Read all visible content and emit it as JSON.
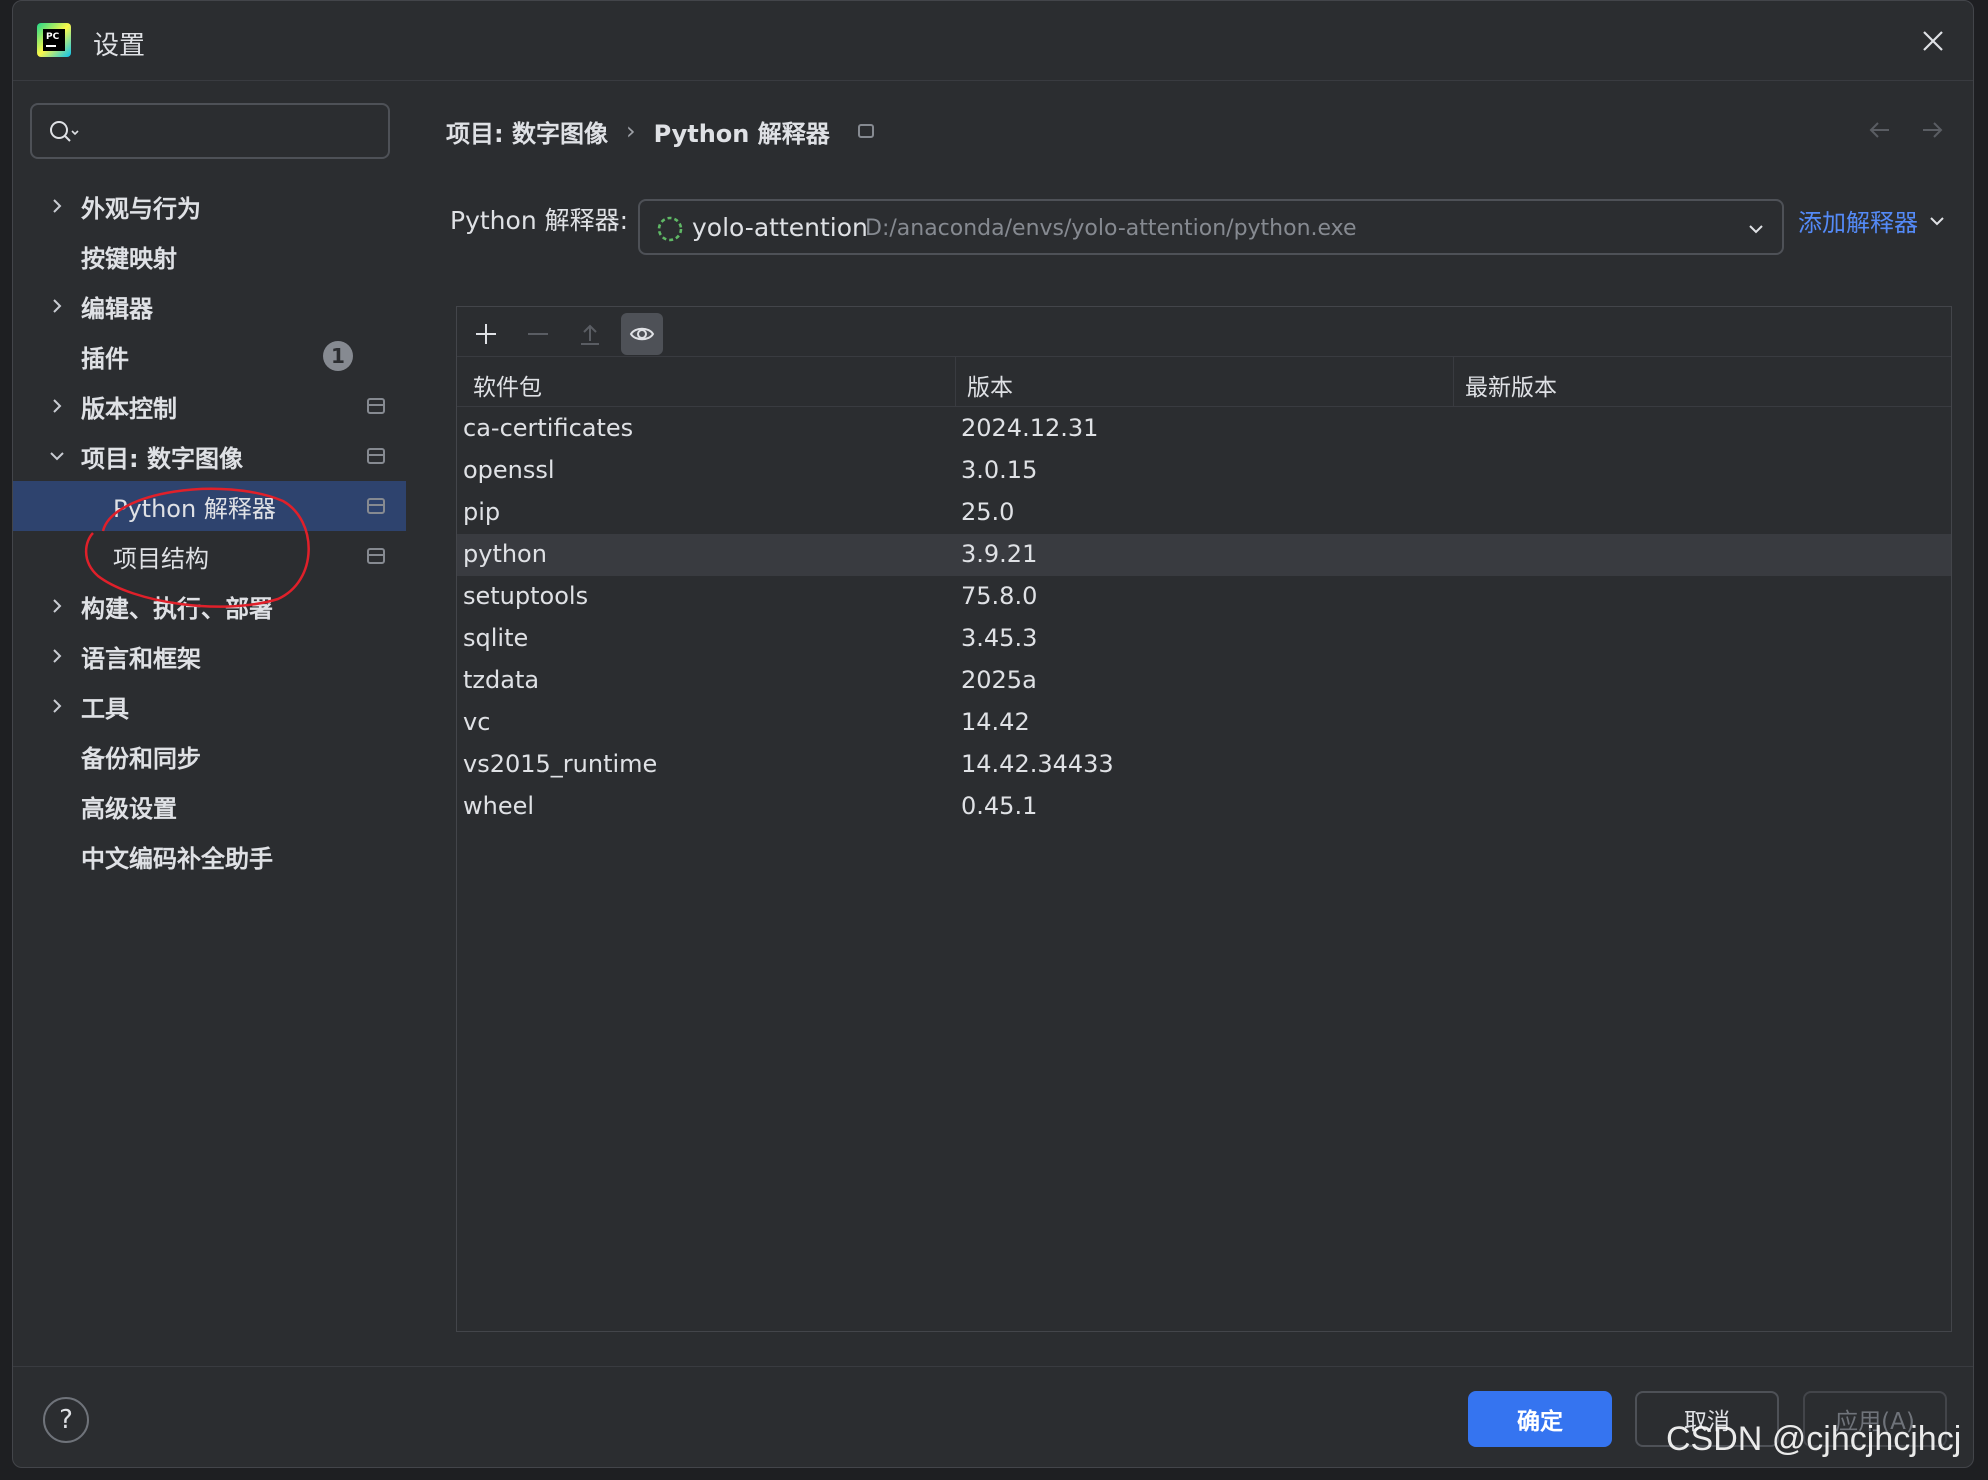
{
  "window": {
    "title": "设置",
    "logo_icon": "pycharm-logo"
  },
  "search": {
    "placeholder": ""
  },
  "sidebar": {
    "items": [
      {
        "label": "外观与行为",
        "expandable": true
      },
      {
        "label": "按键映射",
        "expandable": false
      },
      {
        "label": "编辑器",
        "expandable": true
      },
      {
        "label": "插件",
        "expandable": false,
        "badge": "1"
      },
      {
        "label": "版本控制",
        "expandable": true
      },
      {
        "label": "项目: 数字图像",
        "expandable": true,
        "expanded": true
      },
      {
        "label": "Python 解释器",
        "child": true,
        "selected": true
      },
      {
        "label": "项目结构",
        "child": true
      },
      {
        "label": "构建、执行、部署",
        "expandable": true
      },
      {
        "label": "语言和框架",
        "expandable": true
      },
      {
        "label": "工具",
        "expandable": true
      },
      {
        "label": "备份和同步",
        "expandable": false
      },
      {
        "label": "高级设置",
        "expandable": false
      },
      {
        "label": "中文编码补全助手",
        "expandable": false
      }
    ]
  },
  "breadcrumb": {
    "parent": "项目: 数字图像",
    "separator": "›",
    "current": "Python 解释器"
  },
  "interpreter": {
    "label": "Python 解释器:",
    "name": "yolo-attention",
    "path": "D:/anaconda/envs/yolo-attention/python.exe",
    "add_label": "添加解释器"
  },
  "packages": {
    "columns": [
      "软件包",
      "版本",
      "最新版本"
    ],
    "rows": [
      {
        "name": "ca-certificates",
        "version": "2024.12.31",
        "latest": ""
      },
      {
        "name": "openssl",
        "version": "3.0.15",
        "latest": ""
      },
      {
        "name": "pip",
        "version": "25.0",
        "latest": ""
      },
      {
        "name": "python",
        "version": "3.9.21",
        "latest": ""
      },
      {
        "name": "setuptools",
        "version": "75.8.0",
        "latest": ""
      },
      {
        "name": "sqlite",
        "version": "3.45.3",
        "latest": ""
      },
      {
        "name": "tzdata",
        "version": "2025a",
        "latest": ""
      },
      {
        "name": "vc",
        "version": "14.42",
        "latest": ""
      },
      {
        "name": "vs2015_runtime",
        "version": "14.42.34433",
        "latest": ""
      },
      {
        "name": "wheel",
        "version": "0.45.1",
        "latest": ""
      }
    ]
  },
  "footer": {
    "help_label": "?",
    "ok_label": "确定",
    "cancel_label": "取消",
    "apply_label": "应用(A)"
  },
  "watermark": "CSDN @cjhcjhcjhcj",
  "colors": {
    "accent": "#3574f0",
    "link": "#548af7",
    "selection": "#2e436e",
    "annotation": "#e0202a"
  }
}
